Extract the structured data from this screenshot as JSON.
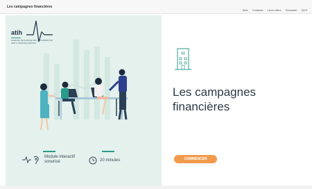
{
  "header": {
    "app_title": "Les campagnes financières",
    "nav": [
      "Aide",
      "Contacts",
      "Liens utiles",
      "Glossaire",
      "QUIT"
    ]
  },
  "logo": {
    "name": "atih",
    "subtitle": "AGENCE TECHNIQUE DE L'INFORMATION SUR L'HOSPITALISATION"
  },
  "footer": {
    "module_label_line1": "Module interactif",
    "module_label_line2": "sonorisé",
    "duration_label": "20 minutes"
  },
  "main": {
    "title_line1": "Les campagnes",
    "title_line2": "financières",
    "start_button": "COMMENCER"
  },
  "colors": {
    "accent_teal": "#2a9a8c",
    "button_orange": "#f29a4d",
    "panel_mint": "#e4f1ec",
    "dark_text": "#2c3a45"
  }
}
